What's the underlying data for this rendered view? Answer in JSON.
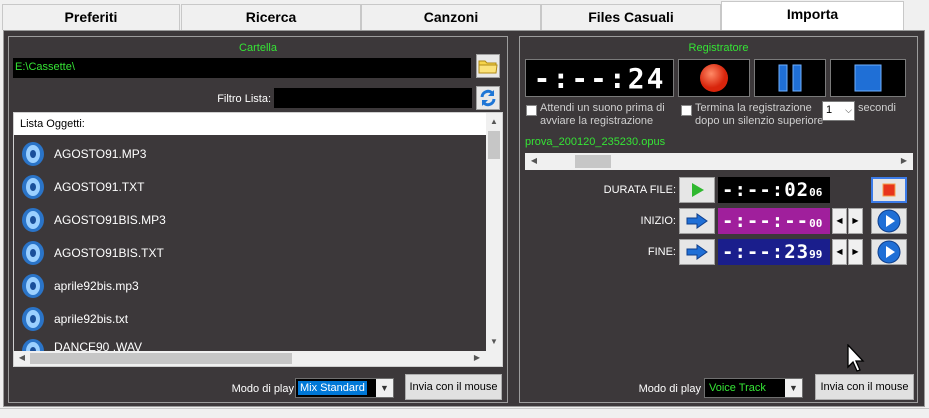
{
  "tabs": [
    {
      "label": "Preferiti"
    },
    {
      "label": "Ricerca"
    },
    {
      "label": "Canzoni"
    },
    {
      "label": "Files Casuali"
    },
    {
      "label": "Importa"
    }
  ],
  "active_tab": "Importa",
  "left_panel": {
    "title": "Cartella",
    "folder_path": "E:\\Cassette\\",
    "filter_label": "Filtro Lista:",
    "filter_value": "",
    "list_header": "Lista Oggetti:",
    "items": [
      {
        "name": "AGOSTO91.MP3"
      },
      {
        "name": "AGOSTO91.TXT"
      },
      {
        "name": "AGOSTO91BIS.MP3"
      },
      {
        "name": "AGOSTO91BIS.TXT"
      },
      {
        "name": "aprile92bis.mp3"
      },
      {
        "name": "aprile92bis.txt"
      },
      {
        "name": "DANCE90 .WAV"
      }
    ],
    "play_mode_label": "Modo di play",
    "play_mode_value": "Mix Standard",
    "send_button": "Invia con il mouse",
    "icons": {
      "folder": "folder-icon",
      "refresh": "refresh-icon",
      "item": "speaker-icon"
    }
  },
  "right_panel": {
    "title": "Registratore",
    "big_timer": "-:--:24",
    "wait_sound_label": "Attendi un suono prima di avviare la registrazione",
    "stop_silence_label": "Termina la registrazione dopo un silenzio superiore",
    "silence_seconds": "1",
    "seconds_label": "secondi",
    "filename": "prova_200120_235230.opus",
    "duration_label": "DURATA FILE:",
    "duration_time": "-:--:02",
    "duration_ms": "06",
    "start_label": "INIZIO:",
    "start_time": "-:--:--",
    "start_ms": "00",
    "end_label": "FINE:",
    "end_time": "-:--:23",
    "end_ms": "99",
    "play_mode_label": "Modo di play",
    "play_mode_value": "Voice Track",
    "send_button": "Invia con il mouse",
    "icons": {
      "record": "record-icon",
      "pause": "pause-icon",
      "stop": "stop-icon",
      "play": "play-icon",
      "arrow": "arrow-right-icon",
      "play_circle": "play-circle-icon"
    }
  },
  "colors": {
    "panel_bg": "#3c383a",
    "accent_green": "#35e435",
    "record_red": "#e8341c",
    "button_blue": "#1f6fd6",
    "start_bg": "#a01f9c",
    "end_bg": "#1a1e8c",
    "selection_blue": "#0078d7"
  }
}
